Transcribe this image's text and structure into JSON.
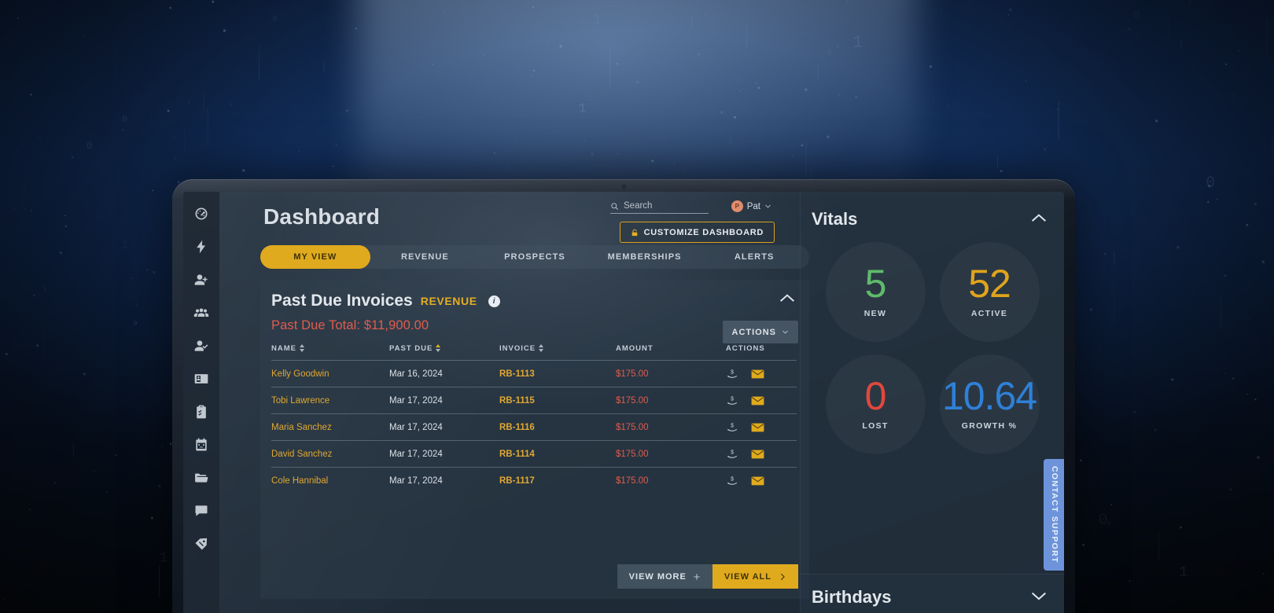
{
  "sidebar": {
    "items": [
      {
        "name": "dashboard",
        "icon": "speedometer-icon"
      },
      {
        "name": "quick-actions",
        "icon": "lightning-bolt-icon"
      },
      {
        "name": "add-contact",
        "icon": "user-plus-icon"
      },
      {
        "name": "groups",
        "icon": "users-icon"
      },
      {
        "name": "members",
        "icon": "user-check-icon"
      },
      {
        "name": "cards",
        "icon": "id-card-icon"
      },
      {
        "name": "tasks",
        "icon": "clipboard-icon"
      },
      {
        "name": "calendar",
        "icon": "calendar-icon"
      },
      {
        "name": "files",
        "icon": "folder-icon"
      },
      {
        "name": "messages",
        "icon": "chat-bubble-icon"
      },
      {
        "name": "tags",
        "icon": "tag-icon"
      }
    ]
  },
  "header": {
    "title": "Dashboard",
    "search_placeholder": "Search",
    "user_name": "Pat",
    "user_initial": "P",
    "customize_label": "CUSTOMIZE DASHBOARD"
  },
  "tabs": [
    {
      "label": "MY VIEW",
      "active": true
    },
    {
      "label": "REVENUE",
      "active": false
    },
    {
      "label": "PROSPECTS",
      "active": false
    },
    {
      "label": "MEMBERSHIPS",
      "active": false
    },
    {
      "label": "ALERTS",
      "active": false
    }
  ],
  "card": {
    "title": "Past Due Invoices",
    "tag": "REVENUE",
    "info_glyph": "i",
    "past_due_total": "Past Due Total: $11,900.00",
    "actions_label": "ACTIONS",
    "columns": [
      "NAME",
      "PAST DUE",
      "INVOICE",
      "AMOUNT",
      "ACTIONS"
    ],
    "rows": [
      {
        "name": "Kelly Goodwin",
        "past_due": "Mar 16, 2024",
        "invoice": "RB-1113",
        "amount": "$175.00"
      },
      {
        "name": "Tobi Lawrence",
        "past_due": "Mar 17, 2024",
        "invoice": "RB-1115",
        "amount": "$175.00"
      },
      {
        "name": "Maria Sanchez",
        "past_due": "Mar 17, 2024",
        "invoice": "RB-1116",
        "amount": "$175.00"
      },
      {
        "name": "David Sanchez",
        "past_due": "Mar 17, 2024",
        "invoice": "RB-1114",
        "amount": "$175.00"
      },
      {
        "name": "Cole Hannibal",
        "past_due": "Mar 17, 2024",
        "invoice": "RB-1117",
        "amount": "$175.00"
      }
    ],
    "view_more_label": "VIEW MORE",
    "view_all_label": "VIEW ALL"
  },
  "vitals": {
    "title": "Vitals",
    "metrics": [
      {
        "value": "5",
        "label": "NEW",
        "color": "#5fbb6a"
      },
      {
        "value": "52",
        "label": "ACTIVE",
        "color": "#e0a41c"
      },
      {
        "value": "0",
        "label": "LOST",
        "color": "#e0483c"
      },
      {
        "value": "10.64",
        "label": "GROWTH %",
        "color": "#2f80d8"
      }
    ]
  },
  "birthdays": {
    "title": "Birthdays"
  },
  "support": {
    "label": "CONTACT SUPPORT"
  },
  "colors": {
    "accent_gold": "#e0aa1e",
    "danger_red": "#e05c4e",
    "support_blue": "#6d94db"
  }
}
